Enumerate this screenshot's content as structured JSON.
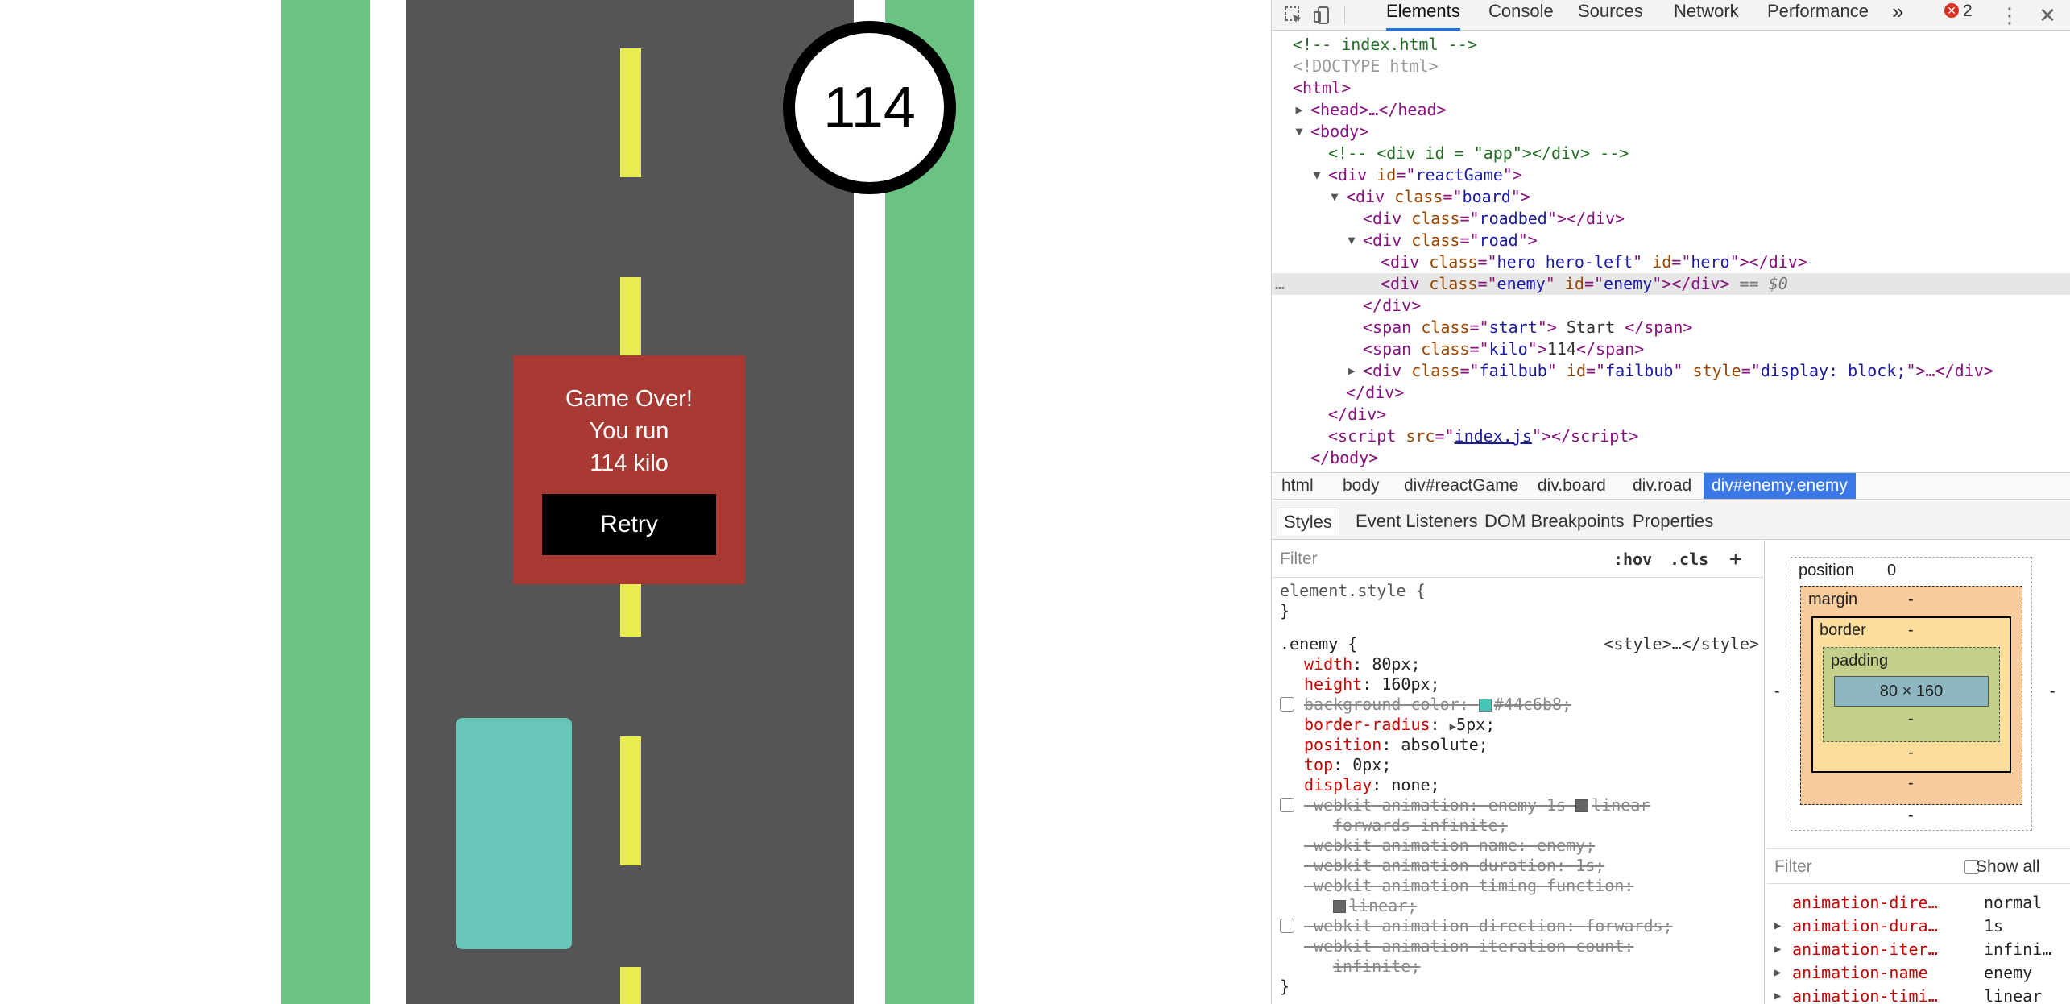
{
  "game": {
    "score": "114",
    "failbub": {
      "line1": "Game Over!",
      "line2": "You run",
      "line3": "114 kilo",
      "retry": "Retry"
    },
    "colors": {
      "grass": "#6bc383",
      "road": "#555555",
      "lane": "#eaed4f",
      "car": "#68c6b8",
      "failbub": "#a93a33"
    }
  },
  "devtools": {
    "tabs": [
      "Elements",
      "Console",
      "Sources",
      "Network",
      "Performance"
    ],
    "more": "»",
    "error_count": "2",
    "tree": {
      "l1": "<!-- index.html -->",
      "l2": "<!DOCTYPE html>",
      "l3": "<html>",
      "l4": "<head>…</head>",
      "l5": "<body>",
      "l6": "<!-- <div id = \"app\"></div> -->",
      "l7_tag": "div",
      "l7_attr": "id",
      "l7_val": "reactGame",
      "l8_tag": "div",
      "l8_attr": "class",
      "l8_val": "board",
      "l9_tag": "div",
      "l9_attr": "class",
      "l9_val": "roadbed",
      "l10_tag": "div",
      "l10_attr": "class",
      "l10_val": "road",
      "l11_val1": "hero hero-left",
      "l11_val2": "hero",
      "l12_val1": "enemy",
      "l12_val2": "enemy",
      "l12_eq": "== $0",
      "l13": "</div>",
      "l14_val": "start",
      "l14_text": " Start ",
      "l15_val": "kilo",
      "l15_text": "114",
      "l16_val1": "failbub",
      "l16_val2": "failbub",
      "l16_val3": "display: block;",
      "l17": "</div>",
      "l18": "</div>",
      "l19_src": "index.js",
      "l20": "</body>",
      "dots": "…"
    },
    "breadcrumbs": [
      "html",
      "body",
      "div#reactGame",
      "div.board",
      "div.road",
      "div#enemy.enemy"
    ],
    "subtabs": [
      "Styles",
      "Event Listeners",
      "DOM Breakpoints",
      "Properties"
    ],
    "filter_placeholder": "Filter",
    "hov": ":hov",
    "cls": ".cls",
    "plus": "+",
    "element_style": "element.style {",
    "close_brace": "}",
    "rule_selector": ".enemy {",
    "rule_source": "<style>…</style>",
    "props": {
      "width": "80px;",
      "height": "160px;",
      "bg_color": "#44c6b8;",
      "radius": "5px;",
      "position": "absolute;",
      "top": "0px;",
      "display": "none;",
      "anim": "enemy 1s ",
      "anim_linear": "linear",
      "anim_cont": "forwards infinite;",
      "anim_name": "enemy;",
      "anim_dur": "1s;",
      "anim_tf_cont": "linear;",
      "anim_dir": "forwards;",
      "anim_ic_cont": "infinite;"
    },
    "boxmodel": {
      "position": "position",
      "position_val": "0",
      "margin": "margin",
      "border": "border",
      "padding": "padding",
      "content": "80 × 160",
      "dash": "-"
    },
    "computed": {
      "filter_placeholder": "Filter",
      "show_all": "Show all",
      "rows": [
        {
          "k": "animation-dire…",
          "v": "normal"
        },
        {
          "k": "animation-dura…",
          "v": "1s"
        },
        {
          "k": "animation-iter…",
          "v": "infini…"
        },
        {
          "k": "animation-name",
          "v": "enemy"
        },
        {
          "k": "animation-timi…",
          "v": "linear"
        }
      ]
    }
  }
}
